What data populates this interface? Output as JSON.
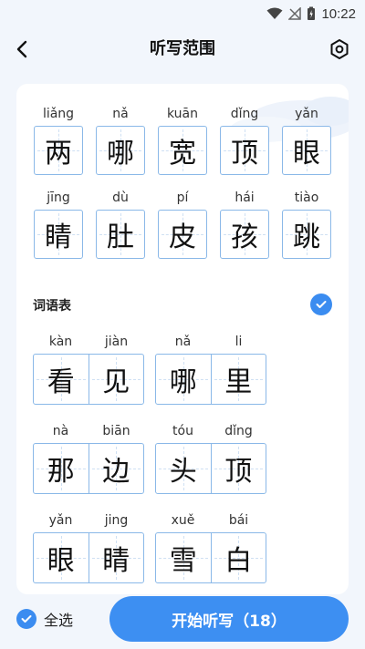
{
  "status_bar": {
    "time": "10:22"
  },
  "header": {
    "title": "听写范围"
  },
  "characters": [
    {
      "pinyin": "liǎng",
      "char": "两"
    },
    {
      "pinyin": "nǎ",
      "char": "哪"
    },
    {
      "pinyin": "kuān",
      "char": "宽"
    },
    {
      "pinyin": "dǐng",
      "char": "顶"
    },
    {
      "pinyin": "yǎn",
      "char": "眼"
    },
    {
      "pinyin": "jīng",
      "char": "睛"
    },
    {
      "pinyin": "dù",
      "char": "肚"
    },
    {
      "pinyin": "pí",
      "char": "皮"
    },
    {
      "pinyin": "hái",
      "char": "孩"
    },
    {
      "pinyin": "tiào",
      "char": "跳"
    }
  ],
  "word_section": {
    "title": "词语表"
  },
  "words": [
    {
      "pinyin": [
        "kàn",
        "jiàn"
      ],
      "chars": [
        "看",
        "见"
      ]
    },
    {
      "pinyin": [
        "nǎ",
        "li"
      ],
      "chars": [
        "哪",
        "里"
      ]
    },
    {
      "pinyin": [
        "nà",
        "biān"
      ],
      "chars": [
        "那",
        "边"
      ]
    },
    {
      "pinyin": [
        "tóu",
        "dǐng"
      ],
      "chars": [
        "头",
        "顶"
      ]
    },
    {
      "pinyin": [
        "yǎn",
        "jing"
      ],
      "chars": [
        "眼",
        "睛"
      ]
    },
    {
      "pinyin": [
        "xuě",
        "bái"
      ],
      "chars": [
        "雪",
        "白"
      ]
    }
  ],
  "bottom": {
    "select_all_label": "全选",
    "start_button_label": "开始听写（18）"
  },
  "colors": {
    "accent": "#3d8ff2",
    "grid_border": "#8ab8e8",
    "background": "#f2f6fc"
  }
}
